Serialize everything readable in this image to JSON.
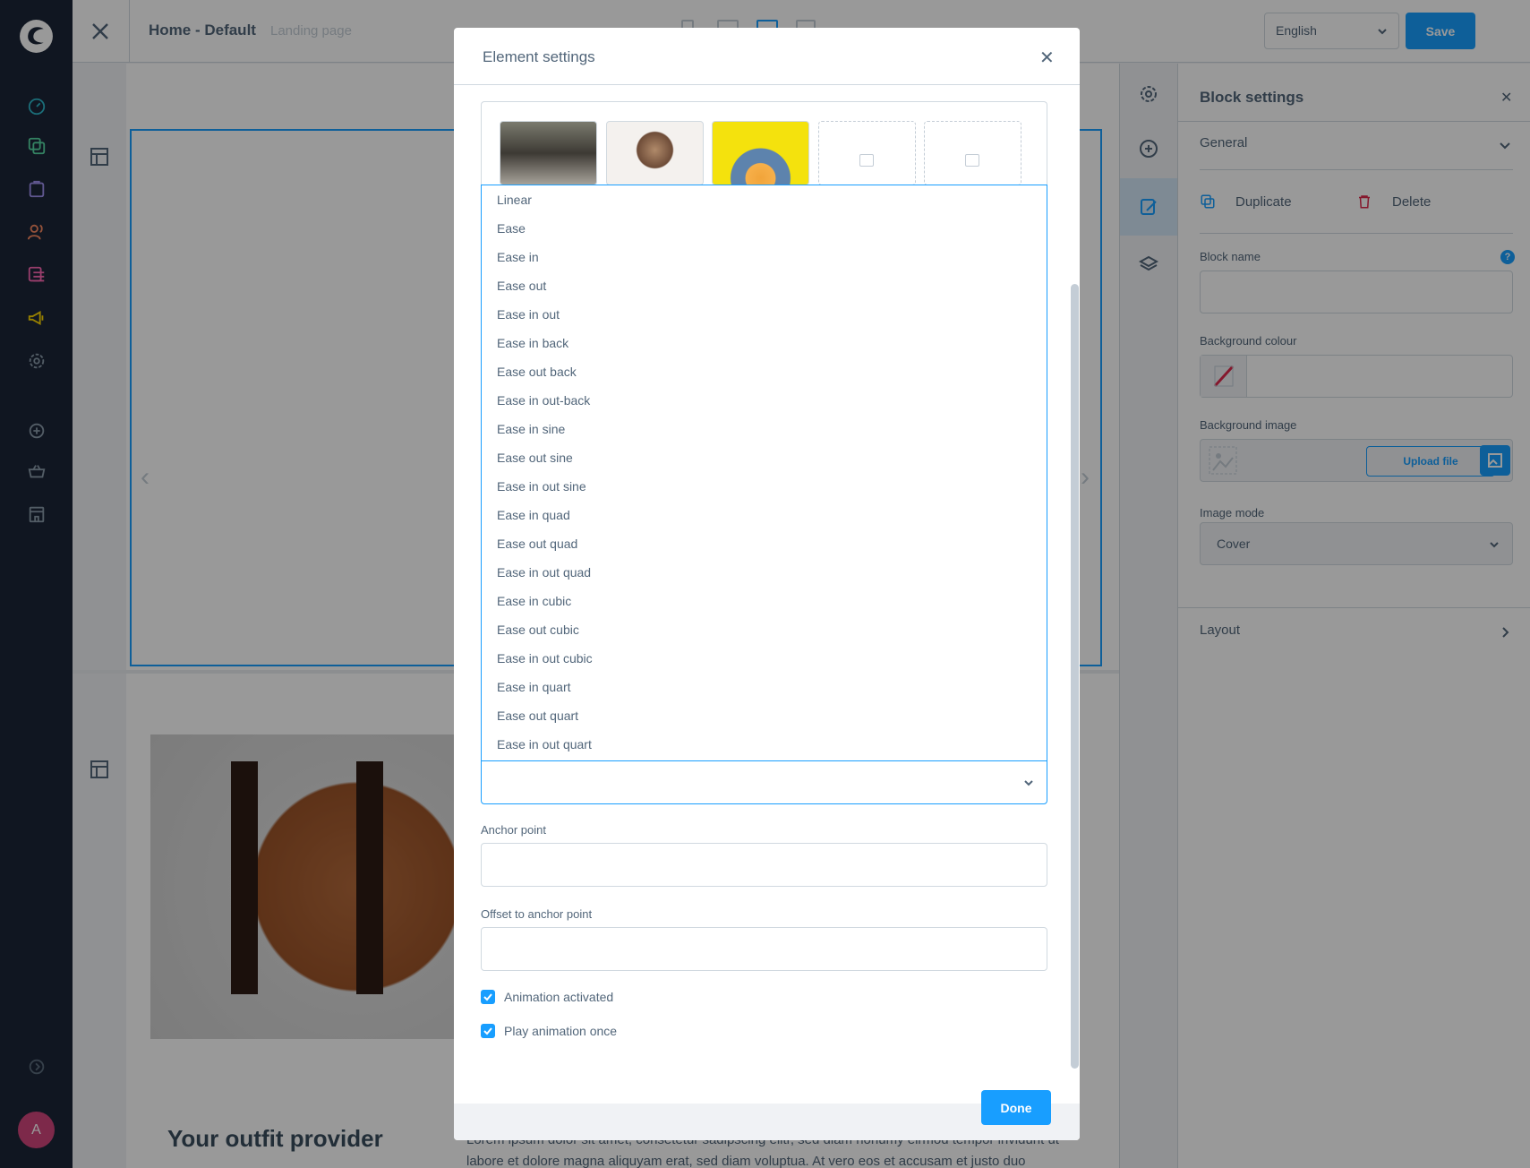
{
  "header": {
    "title": "Home - Default",
    "subtitle": "Landing page",
    "language": "English",
    "save_label": "Save"
  },
  "canvas": {
    "heading": "Your outfit provider",
    "paragraph": "Lorem ipsum dolor sit amet, consetetur sadipscing elitr, sed diam nonumy eirmod tempor invidunt ut labore et dolore magna aliquyam erat, sed diam voluptua. At vero eos et accusam et justo duo"
  },
  "block_settings": {
    "title": "Block settings",
    "general_label": "General",
    "duplicate_label": "Duplicate",
    "delete_label": "Delete",
    "block_name_label": "Block name",
    "background_colour_label": "Background colour",
    "background_image_label": "Background image",
    "upload_label": "Upload file",
    "image_mode_label": "Image mode",
    "image_mode_value": "Cover",
    "layout_label": "Layout",
    "help_glyph": "?"
  },
  "modal": {
    "title": "Element settings",
    "done_label": "Done",
    "easing_options": [
      "Linear",
      "Ease",
      "Ease in",
      "Ease out",
      "Ease in out",
      "Ease in back",
      "Ease out back",
      "Ease in out-back",
      "Ease in sine",
      "Ease out sine",
      "Ease in out sine",
      "Ease in quad",
      "Ease out quad",
      "Ease in out quad",
      "Ease in cubic",
      "Ease out cubic",
      "Ease in out cubic",
      "Ease in quart",
      "Ease out quart",
      "Ease in out quart"
    ],
    "anchor_point_label": "Anchor point",
    "offset_label": "Offset to anchor point",
    "animation_activated_label": "Animation activated",
    "play_once_label": "Play animation once"
  },
  "user": {
    "avatar_initial": "A"
  },
  "colors": {
    "accent": "#189eff",
    "nav_bg": "#1b2537",
    "avatar": "#d1457c"
  }
}
